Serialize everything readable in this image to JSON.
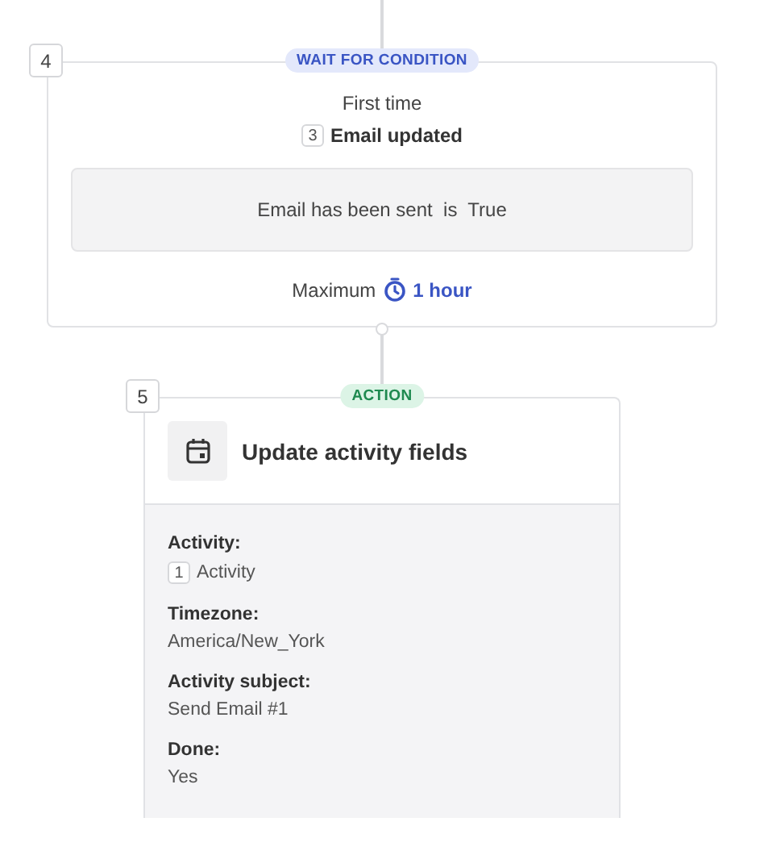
{
  "steps": [
    {
      "kind": "wait",
      "number": "4",
      "badge": "WAIT FOR CONDITION",
      "trigger_label": "First time",
      "trigger_ref": "3",
      "trigger_event": "Email updated",
      "condition": {
        "field": "Email has been sent",
        "operator": "is",
        "value": "True"
      },
      "maximum_label": "Maximum",
      "maximum_value": "1 hour"
    },
    {
      "kind": "action",
      "number": "5",
      "badge": "ACTION",
      "title": "Update activity fields",
      "fields": [
        {
          "label": "Activity:",
          "ref": "1",
          "value": "Activity"
        },
        {
          "label": "Timezone:",
          "value": "America/New_York"
        },
        {
          "label": "Activity subject:",
          "value": "Send Email #1"
        },
        {
          "label": "Done:",
          "value": "Yes"
        }
      ]
    }
  ]
}
